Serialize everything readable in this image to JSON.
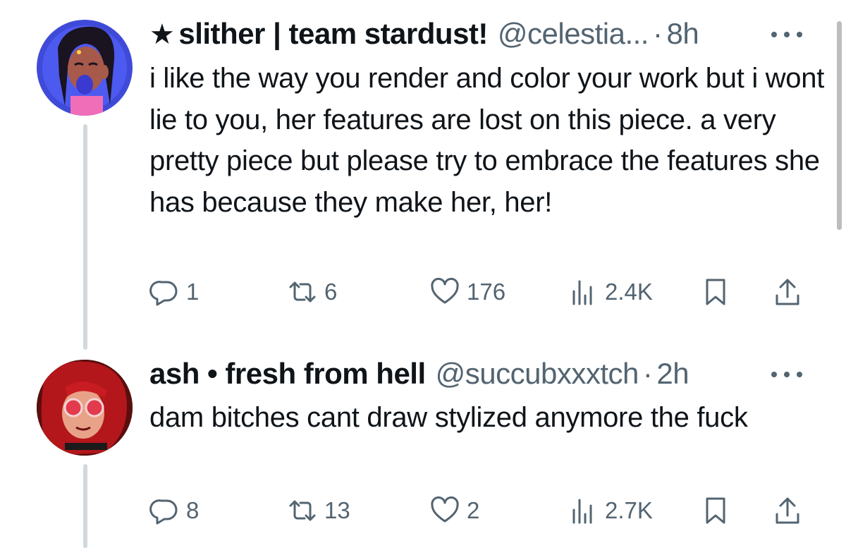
{
  "tweets": [
    {
      "star": "★",
      "display_name": "slither | team stardust!",
      "handle": "@celestia...",
      "separator": "·",
      "time": "8h",
      "body": "i like the way you render and color your work but i wont lie to you, her features are lost on this piece. a very pretty piece but please try to embrace the features she has because they make her, her!",
      "reply_count": "1",
      "retweet_count": "6",
      "like_count": "176",
      "view_count": "2.4K"
    },
    {
      "display_name": "ash • fresh from hell",
      "handle": "@succubxxxtch",
      "separator": "·",
      "time": "2h",
      "body": "dam bitches cant draw stylized anymore the fuck",
      "reply_count": "8",
      "retweet_count": "13",
      "like_count": "2",
      "view_count": "2.7K"
    }
  ],
  "icons": {
    "reply": "reply-icon",
    "retweet": "retweet-icon",
    "like": "heart-icon",
    "views": "views-icon",
    "bookmark": "bookmark-icon",
    "share": "share-icon",
    "more": "more-options-icon"
  },
  "colors": {
    "text": "#0f1419",
    "secondary": "#536471",
    "thread_line": "#cfd9de"
  }
}
